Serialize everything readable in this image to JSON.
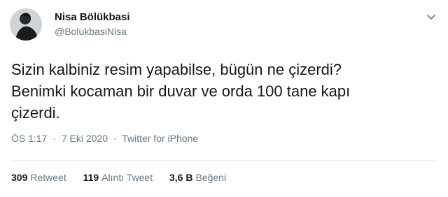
{
  "author": {
    "display_name": "Nisa Bölükbasi",
    "handle": "@BolukbasiNisa"
  },
  "tweet": {
    "lines": [
      "Sizin kalbiniz resim yapabilse, bügün ne çizerdi?",
      "Benimki kocaman bir duvar ve orda 100 tane kapı",
      "çizerdi."
    ]
  },
  "meta": {
    "time": "ÖS 1:17",
    "separator": "·",
    "date": "7 Eki 2020",
    "source": "Twitter for iPhone"
  },
  "stats": [
    {
      "count": "309",
      "label": "Retweet"
    },
    {
      "count": "119",
      "label": "Alıntı Tweet"
    },
    {
      "count": "3,6 B",
      "label": "Beğeni"
    }
  ],
  "icons": {
    "menu": "chevron-down-icon",
    "avatar": "avatar"
  },
  "colors": {
    "text": "#14171a",
    "secondary": "#657786",
    "divider": "#e6ecf0"
  }
}
